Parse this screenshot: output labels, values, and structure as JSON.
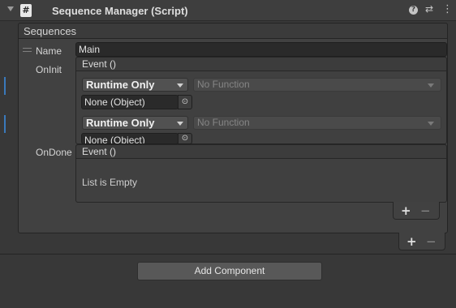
{
  "component": {
    "title": "Sequence Manager (Script)",
    "script_icon_glyph": "#",
    "help_icon_glyph": "?",
    "preset_icon_glyph": "⇄",
    "menu_icon_glyph": "⋮"
  },
  "sequences": {
    "label": "Sequences",
    "element": {
      "name_label": "Name",
      "name_value": "Main",
      "oninit_label": "OnInit",
      "ondone_label": "OnDone"
    }
  },
  "on_init": {
    "header": "Event ()",
    "listeners": [
      {
        "runtime_mode": "Runtime Only",
        "function": "No Function",
        "target": "None (Object)"
      },
      {
        "runtime_mode": "Runtime Only",
        "function": "No Function",
        "target": "None (Object)"
      }
    ]
  },
  "on_done": {
    "header": "Event ()",
    "empty_text": "List is Empty"
  },
  "buttons": {
    "plus": "+",
    "minus": "−",
    "picker_glyph": "⊙",
    "add_component": "Add Component"
  },
  "colors": {
    "background": "#383838",
    "header": "#3e3e3e",
    "accent_marker": "#3a79bb",
    "field": "#2a2a2a"
  }
}
